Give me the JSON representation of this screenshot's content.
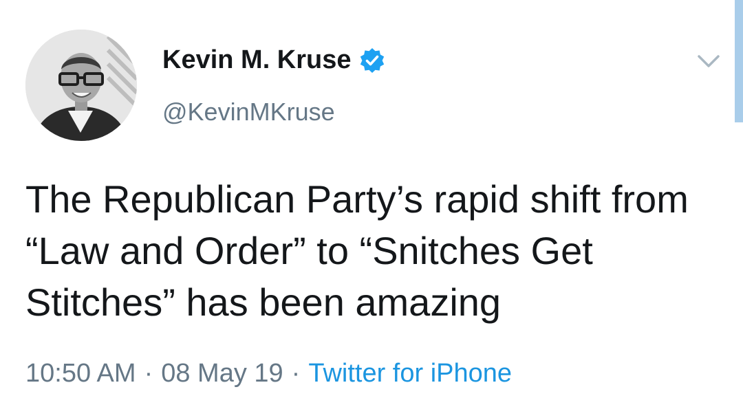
{
  "author": {
    "display_name": "Kevin M. Kruse",
    "handle": "@KevinMKruse",
    "verified": true,
    "avatar_icon": "profile-photo"
  },
  "tweet": {
    "text": "The Republican Party’s rapid shift from “Law and Order” to “Snitches Get Stitches” has been amazing",
    "time": "10:50 AM",
    "date": "08 May 19",
    "source": "Twitter for iPhone",
    "separator": "·"
  },
  "icons": {
    "verified": "verified-badge-icon",
    "menu": "chevron-down-icon"
  },
  "colors": {
    "primary_text": "#14171a",
    "secondary_text": "#657786",
    "link": "#1b95e0",
    "verified_badge": "#1da1f2"
  }
}
